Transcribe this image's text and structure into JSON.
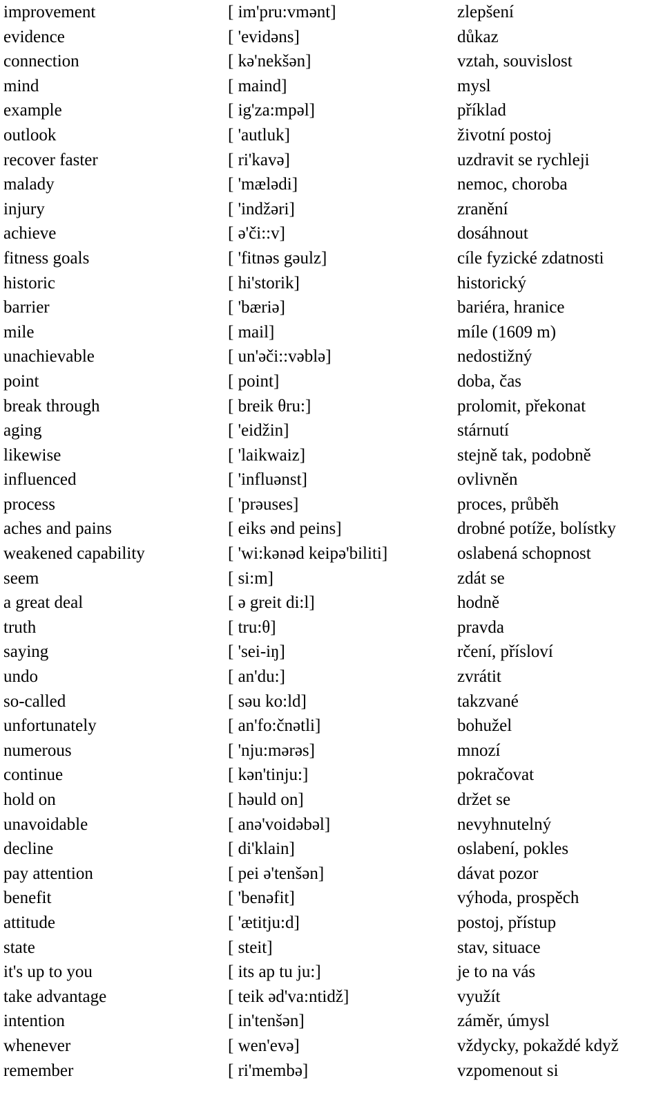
{
  "document": {
    "type": "vocabulary-list",
    "columns": [
      "term",
      "phonetic",
      "translation"
    ],
    "source_language": "English",
    "target_language": "Czech",
    "background_color": "#ffffff",
    "text_color": "#000000"
  },
  "rows": [
    {
      "term": "improvement",
      "phonetic": "[ im'pru:vmənt]",
      "translation": "zlepšení"
    },
    {
      "term": "evidence",
      "phonetic": "[ 'evidəns]",
      "translation": "důkaz"
    },
    {
      "term": "connection",
      "phonetic": "[ kə'nekšən]",
      "translation": "vztah, souvislost"
    },
    {
      "term": "mind",
      "phonetic": "[ maind]",
      "translation": "mysl"
    },
    {
      "term": "example",
      "phonetic": "[ ig'za:mpəl]",
      "translation": "příklad"
    },
    {
      "term": "outlook",
      "phonetic": "[ 'autluk]",
      "translation": "životní postoj"
    },
    {
      "term": "recover faster",
      "phonetic": "[ ri'kavə]",
      "translation": "uzdravit se rychleji"
    },
    {
      "term": "malady",
      "phonetic": "[ 'mælədi]",
      "translation": "nemoc, choroba"
    },
    {
      "term": "injury",
      "phonetic": "[ 'indžəri]",
      "translation": "zranění"
    },
    {
      "term": "achieve",
      "phonetic": "[ ə'či::v]",
      "translation": "dosáhnout"
    },
    {
      "term": "fitness goals",
      "phonetic": "[ 'fitnəs gəulz]",
      "translation": "cíle fyzické zdatnosti"
    },
    {
      "term": "historic",
      "phonetic": "[ hi'storik]",
      "translation": "historický"
    },
    {
      "term": "barrier",
      "phonetic": "[ 'bæriə]",
      "translation": "bariéra, hranice"
    },
    {
      "term": "mile",
      "phonetic": "[ mail]",
      "translation": "míle (1609 m)"
    },
    {
      "term": "unachievable",
      "phonetic": "[ un'əči::vəblə]",
      "translation": "nedostižný"
    },
    {
      "term": "point",
      "phonetic": "[ point]",
      "translation": "doba, čas"
    },
    {
      "term": "break through",
      "phonetic": "[ breik θru:]",
      "translation": "prolomit, překonat"
    },
    {
      "term": "aging",
      "phonetic": "[ 'eidžin]",
      "translation": "stárnutí"
    },
    {
      "term": "likewise",
      "phonetic": "[ 'laikwaiz]",
      "translation": "stejně tak, podobně"
    },
    {
      "term": "influenced",
      "phonetic": "[ 'influənst]",
      "translation": "ovlivněn"
    },
    {
      "term": "process",
      "phonetic": "[ 'prəuses]",
      "translation": "proces, průběh"
    },
    {
      "term": "aches and pains",
      "phonetic": "[ eiks ənd peins]",
      "translation": "drobné potíže, bolístky"
    },
    {
      "term": "weakened capability",
      "phonetic": "[ 'wi:kənəd keipə'biliti]",
      "translation": "oslabená schopnost"
    },
    {
      "term": "seem",
      "phonetic": "[ si:m]",
      "translation": "zdát se"
    },
    {
      "term": "a great deal",
      "phonetic": "[ ə greit di:l]",
      "translation": "hodně"
    },
    {
      "term": "truth",
      "phonetic": "[ tru:θ]",
      "translation": "pravda"
    },
    {
      "term": "saying",
      "phonetic": "[ 'sei-iŋ]",
      "translation": "rčení, přísloví"
    },
    {
      "term": "undo",
      "phonetic": "[ an'du:]",
      "translation": "zvrátit"
    },
    {
      "term": "so-called",
      "phonetic": "[ səu ko:ld]",
      "translation": "takzvané"
    },
    {
      "term": "unfortunately",
      "phonetic": "[ an'fo:čnətli]",
      "translation": "bohužel"
    },
    {
      "term": "numerous",
      "phonetic": "[ 'nju:mərəs]",
      "translation": "mnozí"
    },
    {
      "term": "continue",
      "phonetic": "[ kən'tinju:]",
      "translation": "pokračovat"
    },
    {
      "term": "hold on",
      "phonetic": "[ həuld on]",
      "translation": "držet se"
    },
    {
      "term": "unavoidable",
      "phonetic": "[ anə'voidəbəl]",
      "translation": "nevyhnutelný"
    },
    {
      "term": "decline",
      "phonetic": "[ di'klain]",
      "translation": "oslabení, pokles"
    },
    {
      "term": "pay attention",
      "phonetic": "[ pei ə'tenšən]",
      "translation": "dávat pozor"
    },
    {
      "term": "benefit",
      "phonetic": "[ 'benəfit]",
      "translation": "výhoda, prospěch"
    },
    {
      "term": "attitude",
      "phonetic": "[ 'ætitju:d]",
      "translation": "postoj, přístup"
    },
    {
      "term": "state",
      "phonetic": "[ steit]",
      "translation": "stav, situace"
    },
    {
      "term": "it's up to you",
      "phonetic": "[ its ap tu ju:]",
      "translation": "je to na vás"
    },
    {
      "term": "take advantage",
      "phonetic": "[ teik əd'va:ntidž]",
      "translation": "využít"
    },
    {
      "term": "intention",
      "phonetic": "[ in'tenšən]",
      "translation": "záměr, úmysl"
    },
    {
      "term": "whenever",
      "phonetic": "[ wen'evə]",
      "translation": "vždycky, pokaždé když"
    },
    {
      "term": "remember",
      "phonetic": "[ ri'membə]",
      "translation": "vzpomenout si"
    }
  ]
}
